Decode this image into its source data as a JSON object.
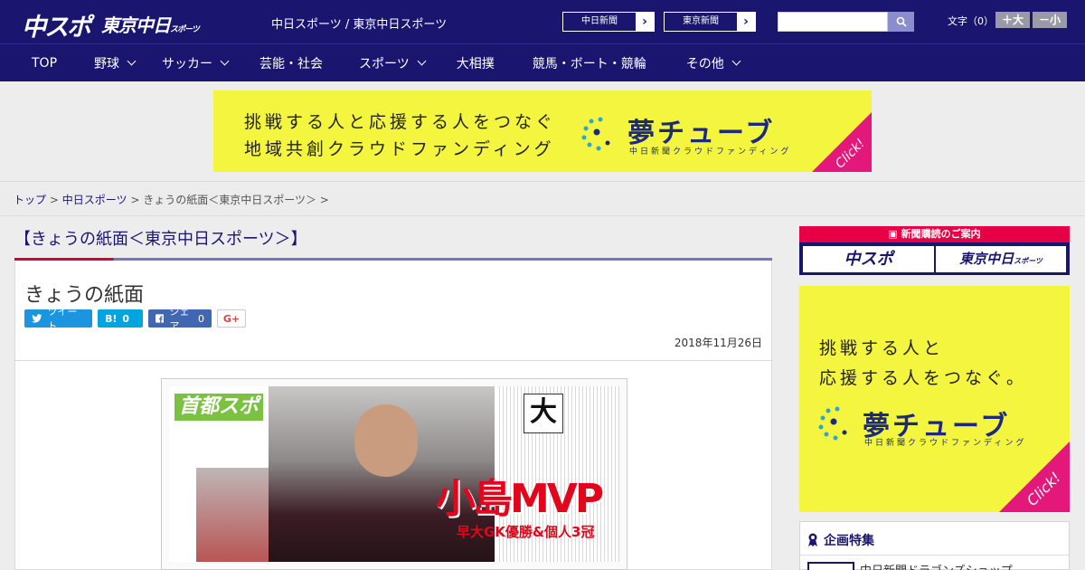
{
  "header": {
    "logo_chuspo": "中スポ",
    "logo_tokyo": "東京中日",
    "logo_tokyo_suffix": "スポーツ",
    "site_link": "中日スポーツ / 東京中日スポーツ",
    "ext_links": [
      "中日新聞",
      "東京新聞"
    ],
    "search_placeholder": "",
    "font_size_label": "文字（0）",
    "font_plus": "＋大",
    "font_minus": "－小"
  },
  "nav": {
    "items": [
      {
        "label": "TOP",
        "has_menu": false
      },
      {
        "label": "野球",
        "has_menu": true
      },
      {
        "label": "サッカー",
        "has_menu": true
      },
      {
        "label": "芸能・社会",
        "has_menu": false
      },
      {
        "label": "スポーツ",
        "has_menu": true
      },
      {
        "label": "大相撲",
        "has_menu": false
      },
      {
        "label": "競馬・ボート・競輪",
        "has_menu": false
      },
      {
        "label": "その他",
        "has_menu": true
      }
    ]
  },
  "banner_top": {
    "line1": "挑戦する人と応援する人をつなぐ",
    "line2": "地域共創クラウドファンディング",
    "brand": "夢チューブ",
    "brand_sub": "中日新聞クラウドファンディング",
    "click": "Click!"
  },
  "breadcrumb": {
    "top": "トップ",
    "sep": ">",
    "section": "中日スポーツ",
    "current": "きょうの紙面＜東京中日スポーツ＞ >"
  },
  "page": {
    "heading": "【きょうの紙面＜東京中日スポーツ＞】",
    "title": "きょうの紙面",
    "date": "2018年11月26日"
  },
  "share": {
    "tweet": "ツイート",
    "hatena_label": "B!",
    "hatena_count": "0",
    "facebook": "シェア",
    "facebook_count": "0",
    "gplus": "G+"
  },
  "paper": {
    "logo": "首都スポ",
    "headline": "小島MVP",
    "sub": "早大GK優勝&個人3冠",
    "dai": "大"
  },
  "sidebar": {
    "subscription_head": "新聞購読のご案内",
    "sub_logo1": "中スポ",
    "sub_logo2": "東京中日",
    "sub_logo2_suffix": "スポーツ",
    "banner_line1": "挑戦する人と",
    "banner_line2": "応援する人をつなぐ。",
    "banner_brand": "夢チューブ",
    "banner_brand_sub": "中日新聞クラウドファンディング",
    "banner_click": "Click!",
    "feature_head": "企画特集",
    "feature_item": "中日新聞ドラゴンズショップ"
  },
  "colors": {
    "header_bg": "#1a1670",
    "accent_red": "#d9003a",
    "banner_yellow": "#f4f53f",
    "click_pink": "#e4177a"
  }
}
